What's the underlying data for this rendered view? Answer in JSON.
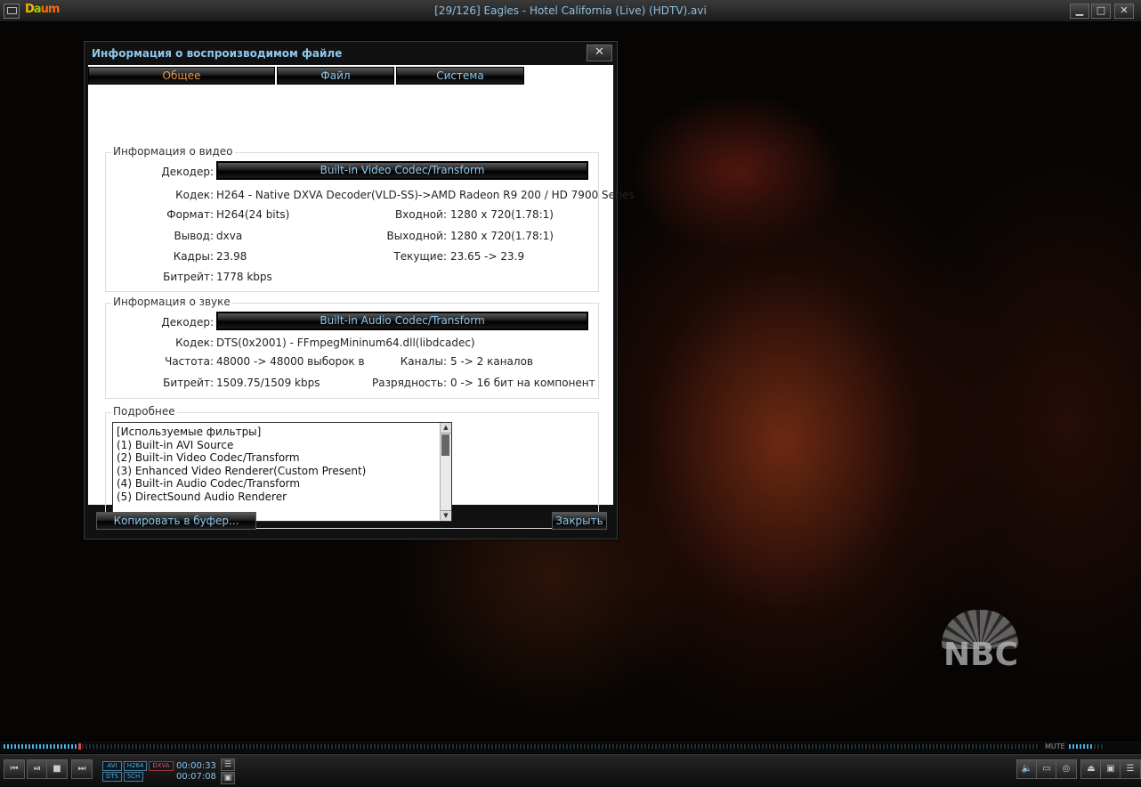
{
  "window": {
    "title": "[29/126] Eagles - Hotel California (Live) (HDTV).avi",
    "logo": {
      "part1": "D",
      "part2": "a",
      "part3": "um"
    },
    "buttons": {
      "minimize": "▁",
      "maximize": "□",
      "close": "✕"
    }
  },
  "video": {
    "watermark": "NBC"
  },
  "dialog": {
    "title": "Информация о воспроизводимом файле",
    "close": "✕",
    "tabs": [
      "Общее",
      "Файл",
      "Система"
    ],
    "video_info": {
      "title": "Информация о видео",
      "decoder_label": "Декодер:",
      "decoder_value": "Built-in Video Codec/Transform",
      "codec_label": "Кодек:",
      "codec_value": "H264 - Native DXVA Decoder(VLD-SS)->AMD Radeon R9 200 / HD 7900 Series",
      "format_label": "Формат:",
      "format_value": "H264(24 bits)",
      "input_label": "Входной:",
      "input_value": "1280 x 720(1.78:1)",
      "output_label": "Вывод:",
      "output_value": "dxva",
      "out_res_label": "Выходной:",
      "out_res_value": "1280 x 720(1.78:1)",
      "frames_label": "Кадры:",
      "frames_value": "23.98",
      "current_label": "Текущие:",
      "current_value": "23.65 -> 23.9",
      "bitrate_label": "Битрейт:",
      "bitrate_value": "1778 kbps"
    },
    "audio_info": {
      "title": "Информация о звуке",
      "decoder_label": "Декодер:",
      "decoder_value": "Built-in Audio Codec/Transform",
      "codec_label": "Кодек:",
      "codec_value": "DTS(0x2001) - FFmpegMininum64.dll(libdcadec)",
      "freq_label": "Частота:",
      "freq_value": "48000 -> 48000 выборок в",
      "channels_label": "Каналы:",
      "channels_value": "5 -> 2 каналов",
      "bitrate_label": "Битрейт:",
      "bitrate_value": "1509.75/1509 kbps",
      "depth_label": "Разрядность:",
      "depth_value": "0 -> 16 бит на компонент"
    },
    "details": {
      "title": "Подробнее",
      "lines": [
        "[Используемые фильтры]",
        "(1) Built-in AVI Source",
        "(2) Built-in Video Codec/Transform",
        "(3) Enhanced Video Renderer(Custom Present)",
        "(4) Built-in Audio Codec/Transform",
        "(5) DirectSound Audio Renderer"
      ]
    },
    "copy_button": "Копировать в буфер...",
    "close_button": "Закрыть"
  },
  "seek": {
    "progress": 0.072,
    "mute_label": "MUTE",
    "volume": 0.7
  },
  "controls": {
    "badges": {
      "container": "AVI",
      "video_codec": "H264",
      "dxva": "DXVA",
      "audio_codec": "DTS",
      "channels": "5CH"
    },
    "time_current": "00:00:33",
    "time_total": "00:07:08",
    "icons": {
      "prev": "⏮",
      "play_pause": "⏯",
      "stop": "■",
      "next": "⏭",
      "speaker": "🔈",
      "subtitle": "▭",
      "capture": "◎",
      "eject": "⏏",
      "settings": "▣",
      "playlist": "☰"
    }
  },
  "colors": {
    "accent": "#8fc7ec",
    "active_tab": "#e8954f",
    "seek": "#4fb2e6",
    "seek_pos": "#e44444"
  }
}
